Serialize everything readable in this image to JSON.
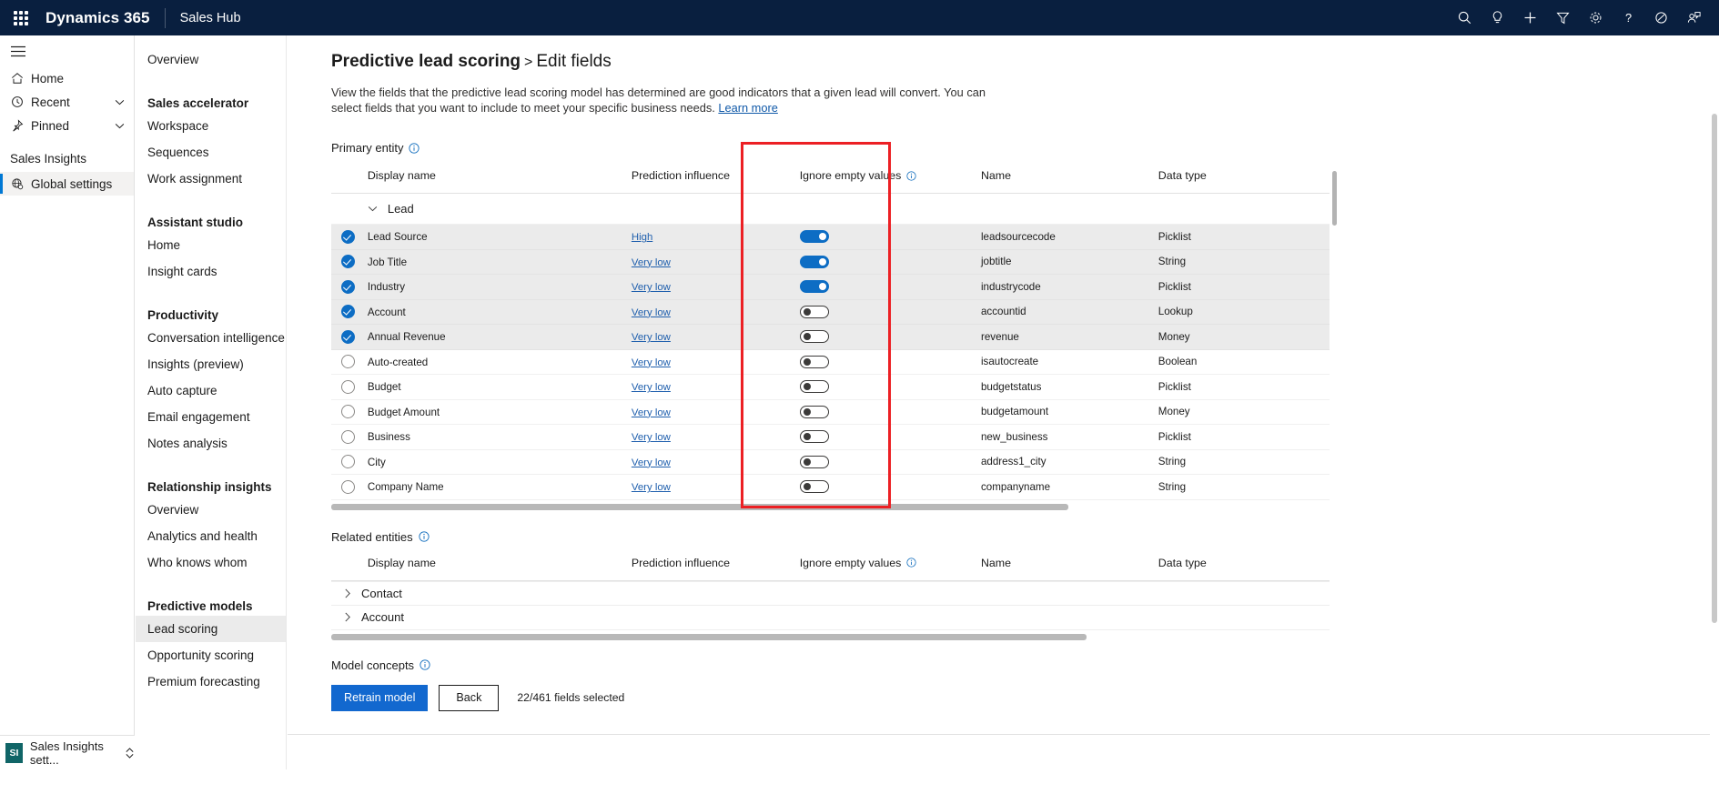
{
  "topbar": {
    "waffle_label": "app-launcher",
    "brand": "Dynamics 365",
    "app_name": "Sales Hub",
    "icons": [
      {
        "name": "search-icon",
        "label": "Search"
      },
      {
        "name": "lightbulb-icon",
        "label": "Assistant"
      },
      {
        "name": "plus-icon",
        "label": "Quick create"
      },
      {
        "name": "filter-icon",
        "label": "Filter"
      },
      {
        "name": "gear-icon",
        "label": "Settings"
      },
      {
        "name": "question-icon",
        "label": "Help"
      },
      {
        "name": "diagnostics-icon",
        "label": "Diagnostics"
      },
      {
        "name": "user-assistant-icon",
        "label": "User"
      }
    ]
  },
  "rail": {
    "hamburger_label": "Show navigation",
    "items": [
      {
        "label": "Home",
        "icon": "home-icon",
        "chevron": false
      },
      {
        "label": "Recent",
        "icon": "clock-icon",
        "chevron": true
      },
      {
        "label": "Pinned",
        "icon": "pin-icon",
        "chevron": true
      }
    ],
    "group_title": "Sales Insights",
    "group_items": [
      {
        "label": "Global settings",
        "icon": "globe-settings-icon",
        "selected": true
      }
    ],
    "bottom": {
      "badge": "SI",
      "label": "Sales Insights sett...",
      "chevron": "area-switcher-icon"
    }
  },
  "sidenav": {
    "items": [
      {
        "label": "Overview",
        "type": "item"
      },
      {
        "label": "Sales accelerator",
        "type": "head"
      },
      {
        "label": "Workspace",
        "type": "item"
      },
      {
        "label": "Sequences",
        "type": "item"
      },
      {
        "label": "Work assignment",
        "type": "item"
      },
      {
        "label": "Assistant studio",
        "type": "head"
      },
      {
        "label": "Home",
        "type": "item"
      },
      {
        "label": "Insight cards",
        "type": "item"
      },
      {
        "label": "Productivity",
        "type": "head"
      },
      {
        "label": "Conversation intelligence",
        "type": "item"
      },
      {
        "label": "Insights (preview)",
        "type": "item"
      },
      {
        "label": "Auto capture",
        "type": "item"
      },
      {
        "label": "Email engagement",
        "type": "item"
      },
      {
        "label": "Notes analysis",
        "type": "item"
      },
      {
        "label": "Relationship insights",
        "type": "head"
      },
      {
        "label": "Overview",
        "type": "item"
      },
      {
        "label": "Analytics and health",
        "type": "item"
      },
      {
        "label": "Who knows whom",
        "type": "item"
      },
      {
        "label": "Predictive models",
        "type": "head"
      },
      {
        "label": "Lead scoring",
        "type": "item",
        "active": true
      },
      {
        "label": "Opportunity scoring",
        "type": "item"
      },
      {
        "label": "Premium forecasting",
        "type": "item"
      }
    ]
  },
  "page": {
    "title": "Predictive lead scoring",
    "title_separator": ">",
    "subtitle": "Edit fields",
    "description": "View the fields that the predictive lead scoring model has determined are good indicators that a given lead will convert. You can select fields that you want to include to meet your specific business needs.",
    "learn_more": "Learn more"
  },
  "primary_entity": {
    "label": "Primary entity",
    "columns": {
      "display_name": "Display name",
      "prediction_influence": "Prediction influence",
      "ignore_empty_values": "Ignore empty values",
      "name": "Name",
      "data_type": "Data type"
    },
    "group": "Lead",
    "rows": [
      {
        "checked": true,
        "display_name": "Lead Source",
        "influence": "High",
        "ignore_empty": true,
        "name": "leadsourcecode",
        "data_type": "Picklist"
      },
      {
        "checked": true,
        "display_name": "Job Title",
        "influence": "Very low",
        "ignore_empty": true,
        "name": "jobtitle",
        "data_type": "String"
      },
      {
        "checked": true,
        "display_name": "Industry",
        "influence": "Very low",
        "ignore_empty": true,
        "name": "industrycode",
        "data_type": "Picklist"
      },
      {
        "checked": true,
        "display_name": "Account",
        "influence": "Very low",
        "ignore_empty": false,
        "name": "accountid",
        "data_type": "Lookup"
      },
      {
        "checked": true,
        "display_name": "Annual Revenue",
        "influence": "Very low",
        "ignore_empty": false,
        "name": "revenue",
        "data_type": "Money"
      },
      {
        "checked": false,
        "display_name": "Auto-created",
        "influence": "Very low",
        "ignore_empty": false,
        "name": "isautocreate",
        "data_type": "Boolean"
      },
      {
        "checked": false,
        "display_name": "Budget",
        "influence": "Very low",
        "ignore_empty": false,
        "name": "budgetstatus",
        "data_type": "Picklist"
      },
      {
        "checked": false,
        "display_name": "Budget Amount",
        "influence": "Very low",
        "ignore_empty": false,
        "name": "budgetamount",
        "data_type": "Money"
      },
      {
        "checked": false,
        "display_name": "Business",
        "influence": "Very low",
        "ignore_empty": false,
        "name": "new_business",
        "data_type": "Picklist"
      },
      {
        "checked": false,
        "display_name": "City",
        "influence": "Very low",
        "ignore_empty": false,
        "name": "address1_city",
        "data_type": "String"
      },
      {
        "checked": false,
        "display_name": "Company Name",
        "influence": "Very low",
        "ignore_empty": false,
        "name": "companyname",
        "data_type": "String"
      }
    ]
  },
  "related_entities": {
    "label": "Related entities",
    "columns": {
      "display_name": "Display name",
      "prediction_influence": "Prediction influence",
      "ignore_empty_values": "Ignore empty values",
      "name": "Name",
      "data_type": "Data type"
    },
    "groups": [
      {
        "label": "Contact"
      },
      {
        "label": "Account"
      }
    ]
  },
  "model_concepts": {
    "label": "Model concepts"
  },
  "footer": {
    "retrain_label": "Retrain model",
    "back_label": "Back",
    "fields_selected": "22/461 fields selected"
  },
  "colors": {
    "brand_navy": "#091F3F",
    "accent_blue": "#0d6dc4",
    "primary_button": "#1268cf",
    "link_blue": "#1f5fad",
    "highlight_red": "#ec2024",
    "row_shade": "#ebebeb"
  }
}
